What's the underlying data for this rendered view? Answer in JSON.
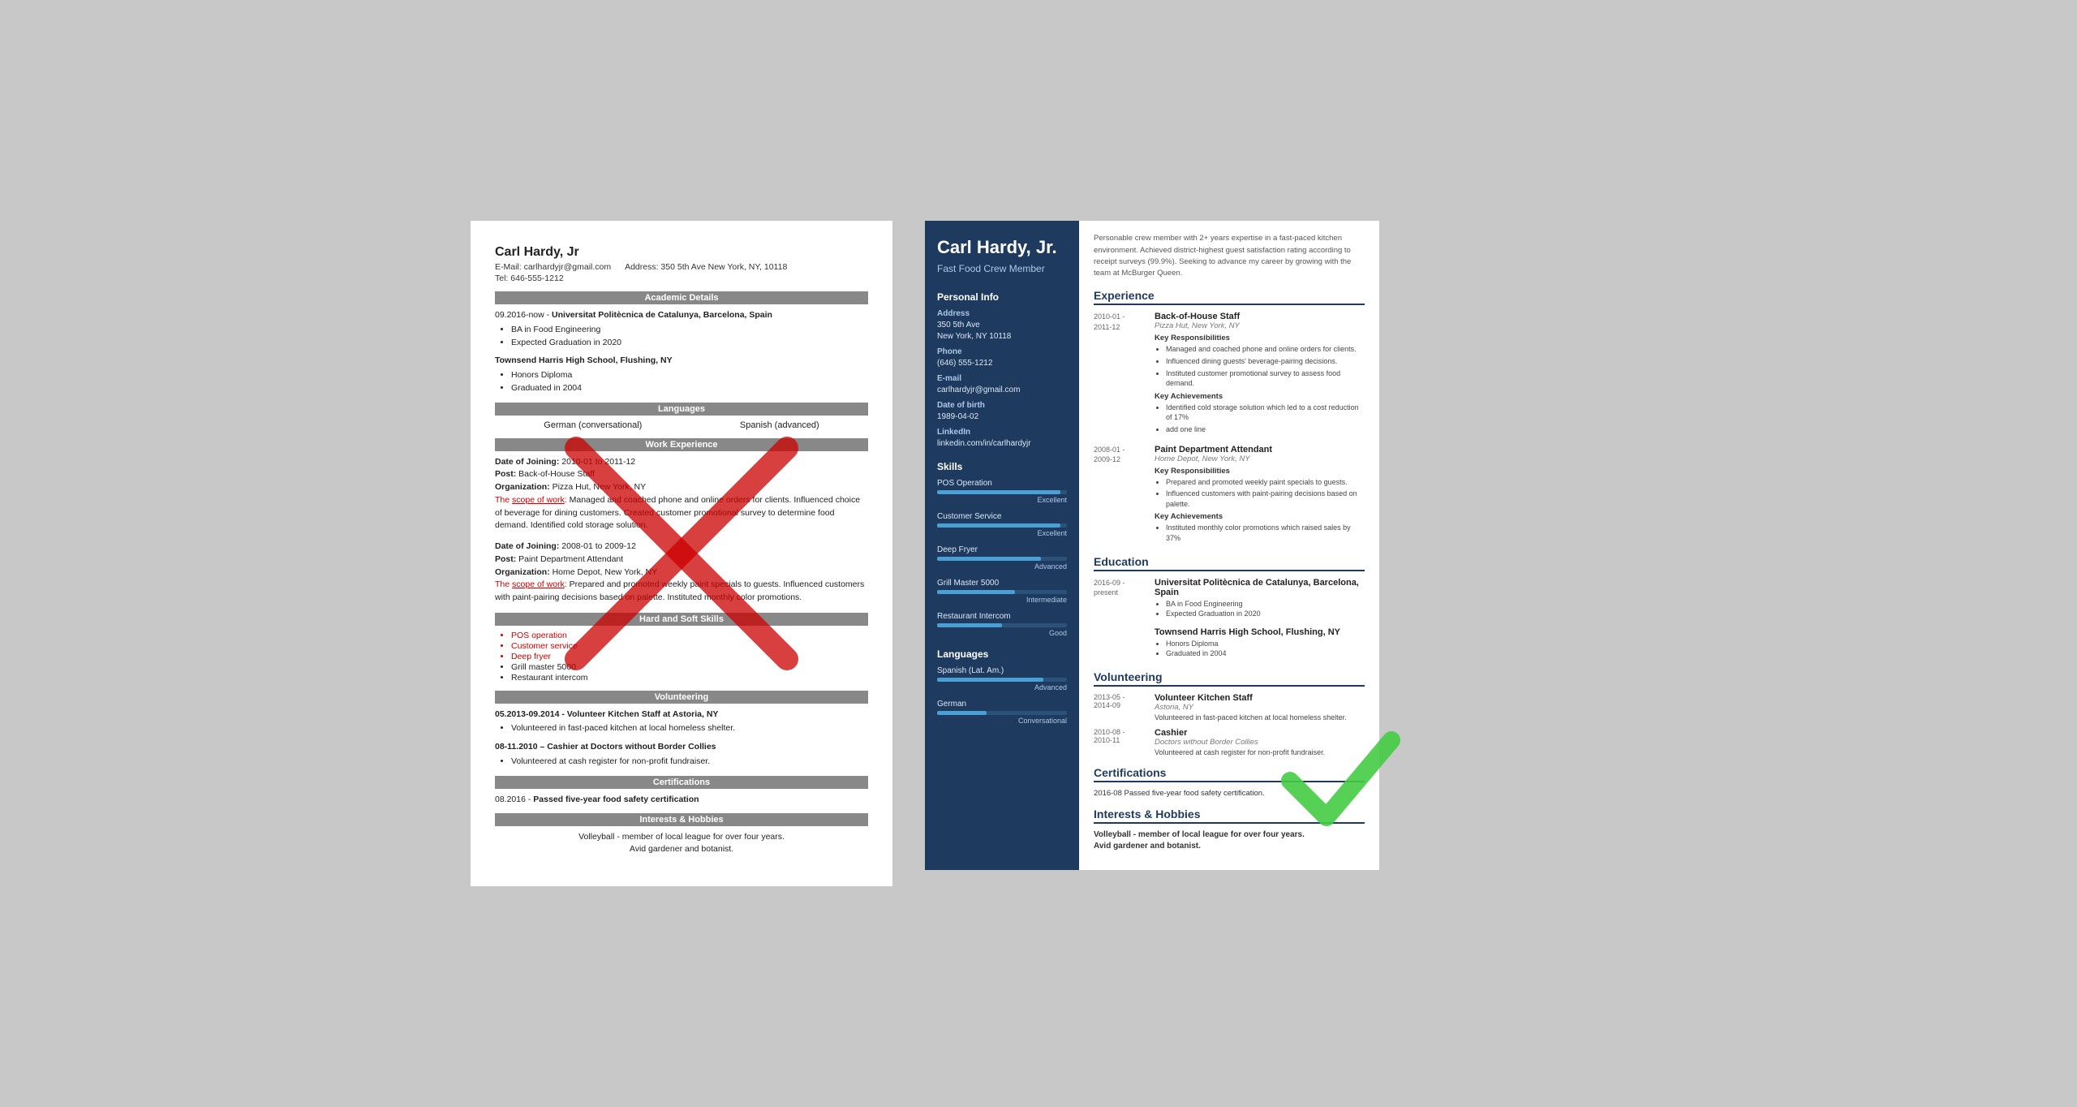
{
  "left_resume": {
    "name": "Carl Hardy, Jr",
    "email_label": "E-Mail:",
    "email": "carlhardyjr@gmail.com",
    "address_label": "Address:",
    "address": "350 5th Ave New York, NY, 10118",
    "tel_label": "Tel:",
    "tel": "646-555-1212",
    "sections": {
      "academic": "Academic Details",
      "languages": "Languages",
      "work": "Work Experience",
      "skills": "Hard and Soft Skills",
      "volunteering": "Volunteering",
      "certifications": "Certifications",
      "interests": "Interests & Hobbies"
    },
    "academic": [
      {
        "dates": "09.2016-now",
        "school": "Universitat Politècnica de Catalunya, Barcelona, Spain",
        "bullets": [
          "BA in Food Engineering",
          "Expected Graduation in 2020"
        ]
      },
      {
        "school": "Townsend Harris High School, Flushing, NY",
        "bullets": [
          "Honors Diploma",
          "Graduated in 2004"
        ]
      }
    ],
    "languages": [
      {
        "name": "German (conversational)"
      },
      {
        "name": "Spanish (advanced)"
      }
    ],
    "work": [
      {
        "dates": "Date of Joining: 2010-01 to 2011-12",
        "post": "Post: Back-of-House Staff",
        "org": "Organization: Pizza Hut, New York, NY",
        "scope_label": "The scope of work:",
        "scope": " Managed and coached phone and online orders for clients. Influenced choice of beverage for dining customers. Created customer promotional survey to determine food demand. Identified cold storage solution."
      },
      {
        "dates": "Date of Joining: 2008-01 to 2009-12",
        "post": "Post: Paint Department Attendant",
        "org": "Organization: Home Depot, New York, NY",
        "scope_label": "The scope of work:",
        "scope": " Prepared and promoted weekly paint specials to guests. Influenced customers with paint-pairing decisions based on palette. Instituted monthly color promotions."
      }
    ],
    "skills": [
      "POS operation",
      "Customer service",
      "Deep fryer",
      "Grill master 5000",
      "Restaurant intercom"
    ],
    "volunteering": [
      {
        "dates": "05.2013-09.2014",
        "title": "Volunteer Kitchen Staff at Astoria, NY",
        "bullets": [
          "Volunteered in fast-paced kitchen at local homeless shelter."
        ]
      },
      {
        "dates": "08-11.2010",
        "title": "Cashier at Doctors without Border Collies",
        "bullets": [
          "Volunteered at cash register for non-profit fundraiser."
        ]
      }
    ],
    "certifications": [
      "08.2016 - Passed five-year food safety certification"
    ],
    "interests": [
      "Volleyball - member of local league for over four years.",
      "Avid gardener and botanist."
    ]
  },
  "right_resume": {
    "name": "Carl Hardy, Jr.",
    "title": "Fast Food Crew Member",
    "summary": "Personable crew member with 2+ years expertise in a fast-paced kitchen environment. Achieved district-highest guest satisfaction rating according to receipt surveys (99.9%). Seeking to advance my career by growing with the team at McBurger Queen.",
    "personal_info_title": "Personal Info",
    "address_label": "Address",
    "address": "350 5th Ave\nNew York, NY 10118",
    "phone_label": "Phone",
    "phone": "(646) 555-1212",
    "email_label": "E-mail",
    "email": "carlhardyjr@gmail.com",
    "dob_label": "Date of birth",
    "dob": "1989-04-02",
    "linkedin_label": "LinkedIn",
    "linkedin": "linkedin.com/in/carlhardyjr",
    "skills_title": "Skills",
    "skills": [
      {
        "name": "POS Operation",
        "level": "Excellent",
        "pct": 95
      },
      {
        "name": "Customer Service",
        "level": "Excellent",
        "pct": 95
      },
      {
        "name": "Deep Fryer",
        "level": "Advanced",
        "pct": 80
      },
      {
        "name": "Grill Master 5000",
        "level": "Intermediate",
        "pct": 60
      },
      {
        "name": "Restaurant Intercom",
        "level": "Good",
        "pct": 50
      }
    ],
    "languages_title": "Languages",
    "languages": [
      {
        "name": "Spanish (Lat. Am.)",
        "level": "Advanced",
        "pct": 82
      },
      {
        "name": "German",
        "level": "Conversational",
        "pct": 38
      }
    ],
    "experience_title": "Experience",
    "experience": [
      {
        "dates": "2010-01 -\n2011-12",
        "title": "Back-of-House Staff",
        "org": "Pizza Hut, New York, NY",
        "responsibilities_title": "Key Responsibilities",
        "responsibilities": [
          "Managed and coached phone and online orders for clients.",
          "Influenced dining guests' beverage-pairing decisions.",
          "Instituted customer promotional survey to assess food demand."
        ],
        "achievements_title": "Key Achievements",
        "achievements": [
          "Identified cold storage solution which led to a cost reduction of 17%",
          "add one line"
        ]
      },
      {
        "dates": "2008-01 -\n2009-12",
        "title": "Paint Department Attendant",
        "org": "Home Depot, New York, NY",
        "responsibilities_title": "Key Responsibilities",
        "responsibilities": [
          "Prepared and promoted weekly paint specials to guests.",
          "Influenced customers with paint-pairing decisions based on palette."
        ],
        "achievements_title": "Key Achievements",
        "achievements": [
          "Instituted monthly color promotions which raised sales by 37%"
        ]
      }
    ],
    "education_title": "Education",
    "education": [
      {
        "dates": "2016-09 -\npresent",
        "school": "Universitat Politècnica de Catalunya, Barcelona, Spain",
        "bullets": [
          "BA in Food Engineering",
          "Expected Graduation in 2020"
        ]
      },
      {
        "school": "Townsend Harris High School, Flushing, NY",
        "bullets": [
          "Honors Diploma",
          "Graduated in 2004"
        ]
      }
    ],
    "volunteering_title": "Volunteering",
    "volunteering": [
      {
        "dates": "2013-05 -\n2014-09",
        "title": "Volunteer Kitchen Staff",
        "org": "Astoria, NY",
        "desc": "Volunteered in fast-paced kitchen at local homeless shelter."
      },
      {
        "dates": "2010-08 -\n2010-11",
        "title": "Cashier",
        "org": "Doctors without Border Collies",
        "desc": "Volunteered at cash register for non-profit fundraiser."
      }
    ],
    "certifications_title": "Certifications",
    "certifications": [
      "2016-08    Passed five-year food safety certification."
    ],
    "interests_title": "Interests & Hobbies",
    "interests": [
      "Volleyball - member of local league for over four years.",
      "Avid gardener and botanist."
    ]
  }
}
